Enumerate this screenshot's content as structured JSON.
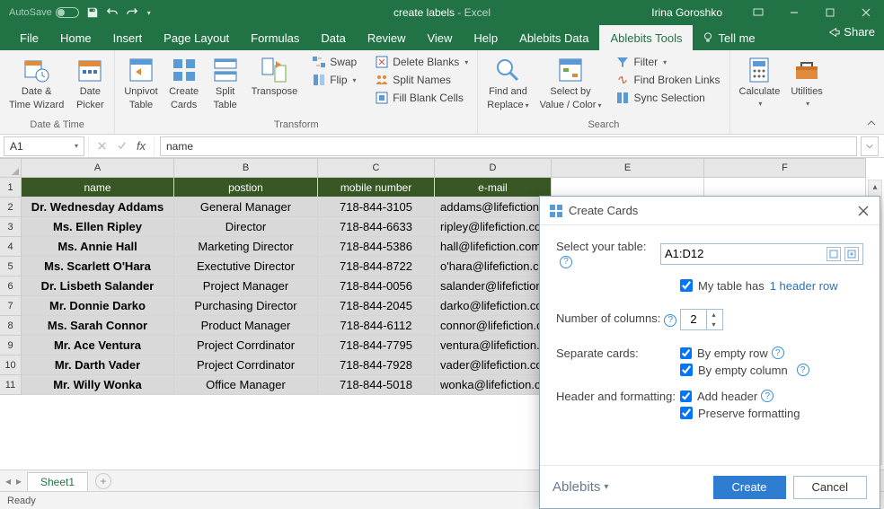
{
  "titlebar": {
    "autosave": "AutoSave",
    "title": "create labels",
    "app_suffix": " - Excel",
    "user": "Irina Goroshko"
  },
  "tabs": {
    "file": "File",
    "home": "Home",
    "insert": "Insert",
    "pagelayout": "Page Layout",
    "formulas": "Formulas",
    "data": "Data",
    "review": "Review",
    "view": "View",
    "help": "Help",
    "abledata": "Ablebits Data",
    "abletools": "Ablebits Tools",
    "tellme": "Tell me"
  },
  "share_label": "Share",
  "ribbon": {
    "group_datetime": "Date & Time",
    "date_time_wizard_l1": "Date &",
    "date_time_wizard_l2": "Time Wizard",
    "date_picker_l1": "Date",
    "date_picker_l2": "Picker",
    "group_transform": "Transform",
    "unpivot_l1": "Unpivot",
    "unpivot_l2": "Table",
    "create_cards_l1": "Create",
    "create_cards_l2": "Cards",
    "split_l1": "Split",
    "split_l2": "Table",
    "transpose": "Transpose",
    "swap": "Swap",
    "flip": "Flip",
    "delete_blanks": "Delete Blanks",
    "split_names": "Split Names",
    "fill_blank": "Fill Blank Cells",
    "group_search": "Search",
    "find_l1": "Find and",
    "find_l2": "Replace",
    "select_l1": "Select by",
    "select_l2": "Value / Color",
    "filter": "Filter",
    "broken": "Find Broken Links",
    "sync": "Sync Selection",
    "calculate": "Calculate",
    "utilities": "Utilities"
  },
  "namebox": "A1",
  "formula_value": "name",
  "columns": [
    "A",
    "B",
    "C",
    "D",
    "E",
    "F"
  ],
  "headers": {
    "A": "name",
    "B": "postion",
    "C": "mobile number",
    "D": "e-mail"
  },
  "rows": [
    {
      "n": "Dr. Wednesday Addams",
      "p": "General Manager",
      "m": "718-844-3105",
      "e": "addams@lifefiction.co"
    },
    {
      "n": "Ms. Ellen Ripley",
      "p": "Director",
      "m": "718-844-6633",
      "e": "ripley@lifefiction.co"
    },
    {
      "n": "Ms. Annie Hall",
      "p": "Marketing Director",
      "m": "718-844-5386",
      "e": "hall@lifefiction.com"
    },
    {
      "n": "Ms. Scarlett O'Hara",
      "p": "Exectutive Director",
      "m": "718-844-8722",
      "e": "o'hara@lifefiction.co"
    },
    {
      "n": "Dr. Lisbeth Salander",
      "p": "Project Manager",
      "m": "718-844-0056",
      "e": "salander@lifefiction.co"
    },
    {
      "n": "Mr. Donnie Darko",
      "p": "Purchasing Director",
      "m": "718-844-2045",
      "e": "darko@lifefiction.co"
    },
    {
      "n": "Ms. Sarah Connor",
      "p": "Product Manager",
      "m": "718-844-6112",
      "e": "connor@lifefiction.co"
    },
    {
      "n": "Mr. Ace Ventura",
      "p": "Project Corrdinator",
      "m": "718-844-7795",
      "e": "ventura@lifefiction.co"
    },
    {
      "n": "Mr. Darth Vader",
      "p": "Project Corrdinator",
      "m": "718-844-7928",
      "e": "vader@lifefiction.co"
    },
    {
      "n": "Mr. Willy Wonka",
      "p": "Office Manager",
      "m": "718-844-5018",
      "e": "wonka@lifefiction.co"
    }
  ],
  "dialog": {
    "title": "Create Cards",
    "select_table": "Select your table:",
    "table_range": "A1:D12",
    "table_has": "My table has",
    "header_rows_link": "1 header row",
    "num_cols_label": "Number of columns:",
    "num_cols_value": "2",
    "separate": "Separate cards:",
    "by_row": "By empty row",
    "by_col": "By empty column",
    "header_fmt": "Header and formatting:",
    "add_header": "Add header",
    "preserve": "Preserve formatting",
    "brand": "Ablebits",
    "create": "Create",
    "cancel": "Cancel"
  },
  "sheet": {
    "tab1": "Sheet1"
  },
  "status": "Ready"
}
